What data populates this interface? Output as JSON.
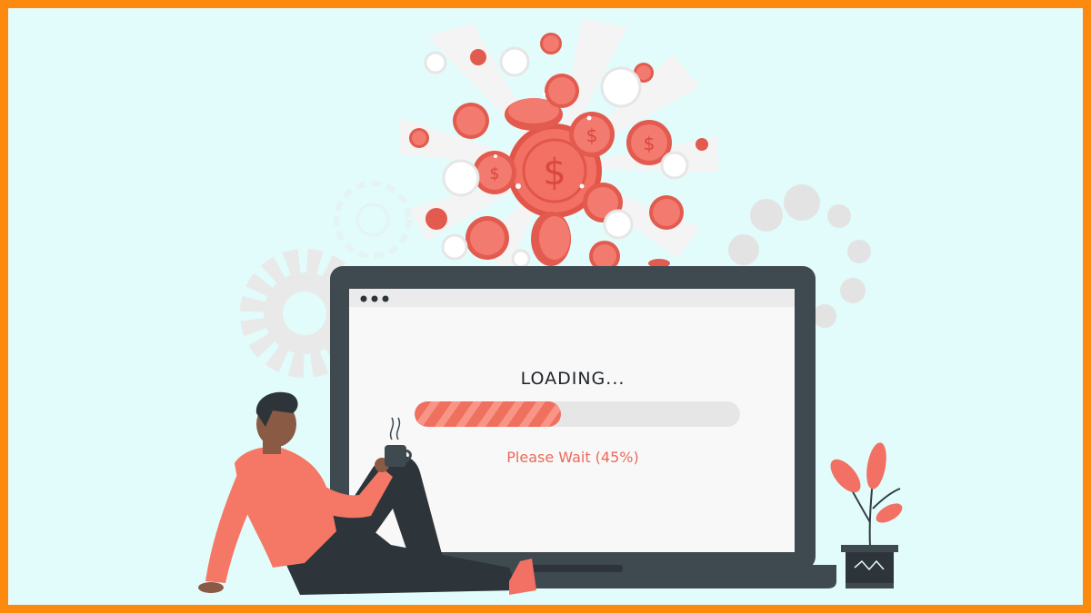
{
  "screen": {
    "title": "LOADING...",
    "status_text": "Please Wait (45%)",
    "progress": 0.45
  },
  "colors": {
    "frame": "#fb8a0e",
    "background": "#e2fbfb",
    "accent": "#f07060",
    "laptop": "#3f4a50"
  },
  "icons": [
    "dollar-coin-icon",
    "gear-icon",
    "plant-icon",
    "coffee-cup-icon",
    "window-dots-icon"
  ]
}
